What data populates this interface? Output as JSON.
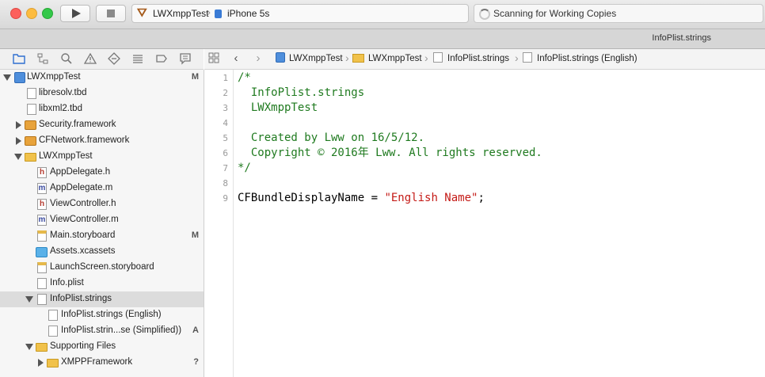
{
  "toolbar": {
    "scheme_target": "LWXmppTest",
    "scheme_device": "iPhone 5s",
    "activity_status": "Scanning for Working Copies"
  },
  "tab": {
    "title": "InfoPlist.strings"
  },
  "jumpbar": {
    "items": [
      "LWXmppTest",
      "LWXmppTest",
      "InfoPlist.strings",
      "InfoPlist.strings (English)"
    ]
  },
  "navigator": {
    "items": [
      {
        "label": "LWXmppTest",
        "status": "M"
      },
      {
        "label": "libresolv.tbd",
        "status": ""
      },
      {
        "label": "libxml2.tbd",
        "status": ""
      },
      {
        "label": "Security.framework",
        "status": ""
      },
      {
        "label": "CFNetwork.framework",
        "status": ""
      },
      {
        "label": "LWXmppTest",
        "status": ""
      },
      {
        "label": "AppDelegate.h",
        "status": ""
      },
      {
        "label": "AppDelegate.m",
        "status": ""
      },
      {
        "label": "ViewController.h",
        "status": ""
      },
      {
        "label": "ViewController.m",
        "status": ""
      },
      {
        "label": "Main.storyboard",
        "status": "M"
      },
      {
        "label": "Assets.xcassets",
        "status": ""
      },
      {
        "label": "LaunchScreen.storyboard",
        "status": ""
      },
      {
        "label": "Info.plist",
        "status": ""
      },
      {
        "label": "InfoPlist.strings",
        "status": ""
      },
      {
        "label": "InfoPlist.strings (English)",
        "status": ""
      },
      {
        "label": "InfoPlist.strin...se (Simplified))",
        "status": "A"
      },
      {
        "label": "Supporting Files",
        "status": ""
      },
      {
        "label": "XMPPFramework",
        "status": "?"
      }
    ]
  },
  "editor": {
    "line_numbers": [
      "1",
      "2",
      "3",
      "4",
      "5",
      "6",
      "7",
      "8",
      "9"
    ],
    "lines": [
      "/*",
      "  InfoPlist.strings",
      "  LWXmppTest",
      "",
      "  Created by Lww on 16/5/12.",
      "  Copyright © 2016年 Lww. All rights reserved.",
      "*/",
      "",
      {
        "key": "CFBundleDisplayName = ",
        "value": "\"English Name\"",
        "end": ";"
      }
    ]
  }
}
